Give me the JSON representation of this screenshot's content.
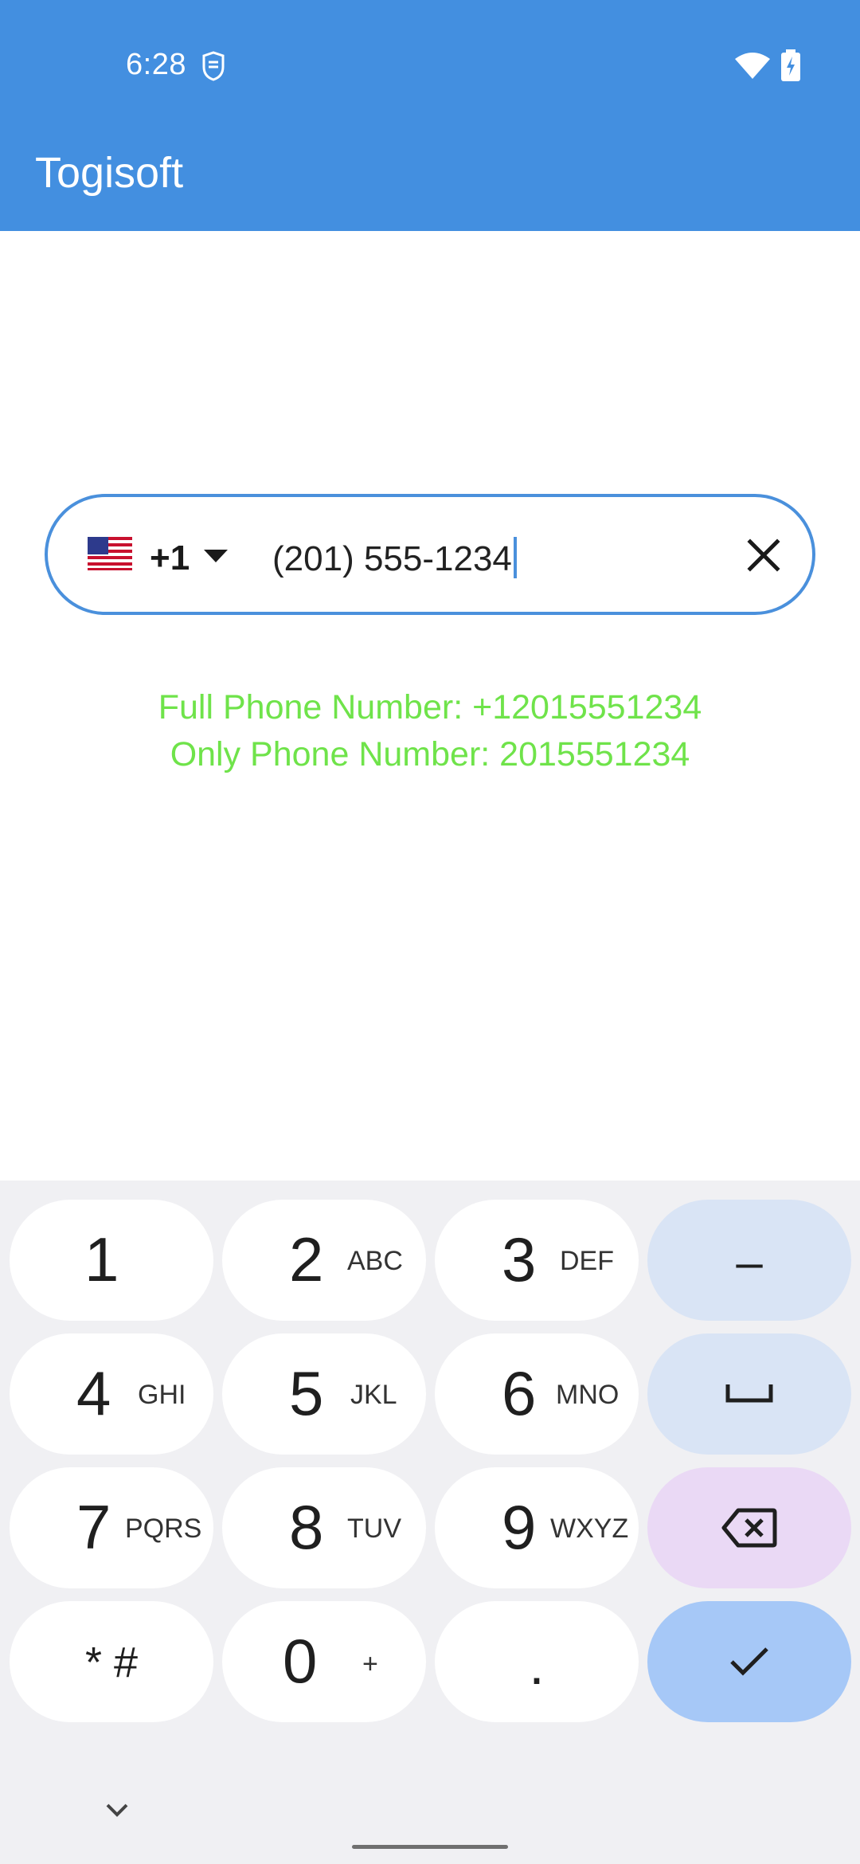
{
  "status_bar": {
    "time": "6:28"
  },
  "app": {
    "title": "Togisoft"
  },
  "phone_field": {
    "country_code": "+1",
    "value": "(201) 555-1234"
  },
  "results": {
    "full": "Full Phone Number: +12015551234",
    "only": "Only Phone Number: 2015551234"
  },
  "keyboard": {
    "keys": [
      {
        "num": "1",
        "letters": ""
      },
      {
        "num": "2",
        "letters": "ABC"
      },
      {
        "num": "3",
        "letters": "DEF"
      },
      {
        "num": "4",
        "letters": "GHI"
      },
      {
        "num": "5",
        "letters": "JKL"
      },
      {
        "num": "6",
        "letters": "MNO"
      },
      {
        "num": "7",
        "letters": "PQRS"
      },
      {
        "num": "8",
        "letters": "TUV"
      },
      {
        "num": "9",
        "letters": "WXYZ"
      },
      {
        "num": "0",
        "letters": "+"
      }
    ],
    "star_hash": "* #",
    "dot": ".",
    "minus": "–"
  },
  "colors": {
    "appbar": "#438fe0",
    "accent": "#4a90dc",
    "result_text": "#6fe34a",
    "key_action": "#d9e4f5",
    "key_delete": "#ead9f5",
    "key_done": "#a6c8f7"
  },
  "icons": {
    "status": [
      "shield-icon",
      "wifi-icon",
      "battery-charging-icon"
    ],
    "field": [
      "us-flag-icon",
      "dropdown-caret-icon",
      "close-icon"
    ],
    "keyboard": [
      "space-icon",
      "backspace-icon",
      "check-icon",
      "chevron-down-icon"
    ]
  }
}
